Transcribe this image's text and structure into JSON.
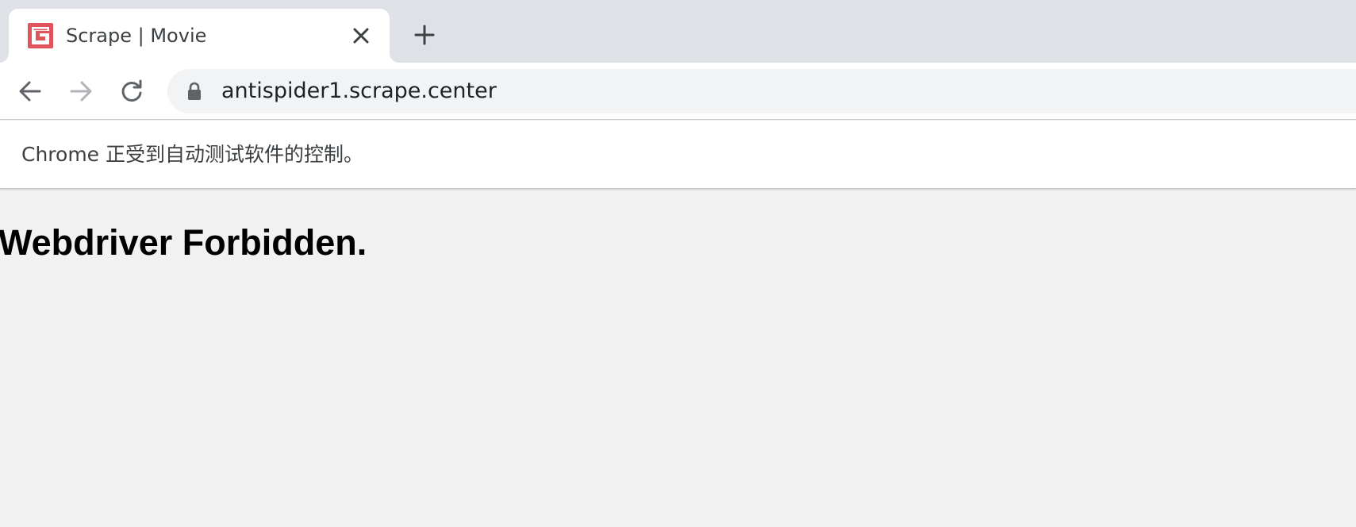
{
  "browser": {
    "tab": {
      "title": "Scrape | Movie",
      "favicon": "scrape-logo-icon",
      "favicon_color": "#e0535a",
      "close_icon": "close-icon"
    },
    "new_tab_icon": "plus-icon",
    "nav": {
      "back_icon": "arrow-left-icon",
      "forward_icon": "arrow-right-icon",
      "forward_enabled": false,
      "reload_icon": "reload-icon"
    },
    "address_bar": {
      "lock_icon": "lock-icon",
      "url": "antispider1.scrape.center"
    },
    "infobar": {
      "message": "Chrome 正受到自动测试软件的控制。"
    }
  },
  "page": {
    "heading": "Webdriver Forbidden."
  },
  "colors": {
    "tabstrip_bg": "#dee1e6",
    "page_bg": "#f1f1f1",
    "omnibox_bg": "#f1f3f4",
    "favicon_red": "#e0535a"
  }
}
